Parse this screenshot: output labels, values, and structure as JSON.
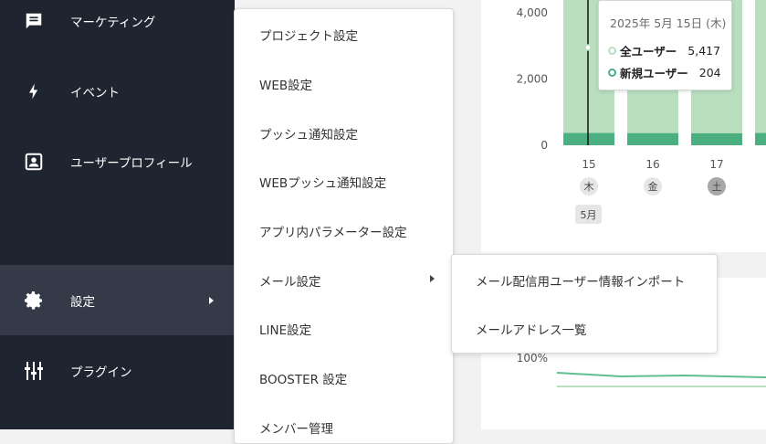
{
  "sidebar": {
    "items": [
      {
        "label": "マーケティング",
        "icon": "message-icon"
      },
      {
        "label": "イベント",
        "icon": "lightning-icon"
      },
      {
        "label": "ユーザープロフィール",
        "icon": "profile-icon"
      },
      {
        "label": "設定",
        "icon": "gear-icon",
        "active": true
      },
      {
        "label": "プラグイン",
        "icon": "sliders-icon"
      }
    ]
  },
  "settings_menu": {
    "items": [
      {
        "label": "プロジェクト設定"
      },
      {
        "label": "WEB設定"
      },
      {
        "label": "プッシュ通知設定"
      },
      {
        "label": "WEBプッシュ通知設定"
      },
      {
        "label": "アプリ内パラメーター設定"
      },
      {
        "label": "メール設定",
        "has_submenu": true
      },
      {
        "label": "LINE設定"
      },
      {
        "label": "BOOSTER 設定"
      },
      {
        "label": "メンバー管理"
      }
    ]
  },
  "mail_submenu": {
    "items": [
      {
        "label": "メール配信用ユーザー情報インポート"
      },
      {
        "label": "メールアドレス一覧"
      }
    ]
  },
  "chart_data": {
    "type": "bar",
    "y_ticks": [
      "4,000",
      "2,000",
      "0"
    ],
    "ylim": [
      0,
      4500
    ],
    "categories": [
      "15",
      "16",
      "17"
    ],
    "weekday_labels": [
      "木",
      "金",
      "土"
    ],
    "month_label": "5月",
    "series": [
      {
        "name": "全ユーザー",
        "values": [
          5417,
          5350,
          5300
        ],
        "color": "#b9dfbf"
      },
      {
        "name": "新規ユーザー",
        "values": [
          204,
          200,
          195
        ],
        "color": "#4caf82"
      }
    ]
  },
  "tooltip": {
    "date": "2025年 5月 15日 (木)",
    "rows": [
      {
        "name": "全ユーザー",
        "value": "5,417",
        "color": "#b9dfbf"
      },
      {
        "name": "新規ユーザー",
        "value": "204",
        "color": "#4caf82"
      }
    ]
  },
  "chart2": {
    "y_label": "100%"
  },
  "colors": {
    "sidebar_bg": "#1f2431",
    "sidebar_active_bg": "#343a48",
    "bar_light": "#b9dfbf",
    "bar_dark": "#4caf82"
  }
}
